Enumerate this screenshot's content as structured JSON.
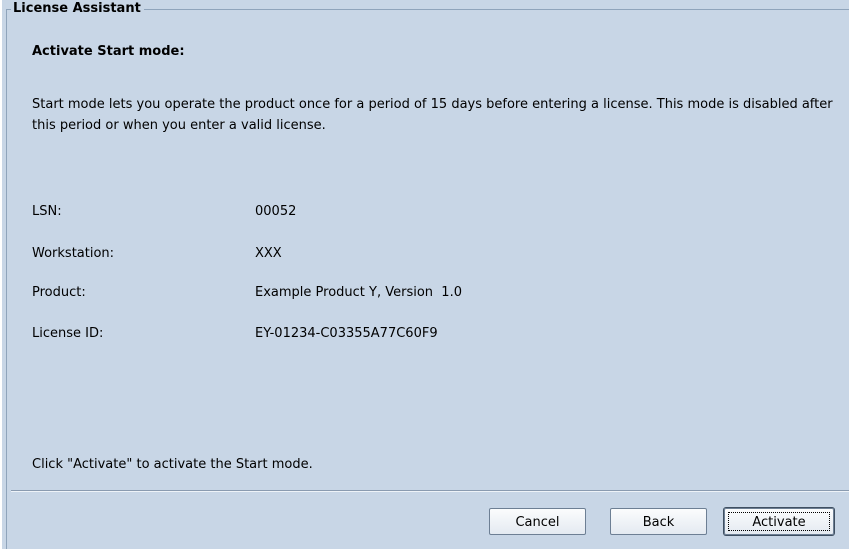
{
  "group_title": "License Assistant",
  "heading": "Activate Start mode:",
  "description": "Start mode lets you operate the product once for a period of 15 days before entering a license. This mode is disabled after this period or when you enter a valid license.",
  "fields": [
    {
      "label": "LSN:",
      "value": "00052"
    },
    {
      "label": "Workstation:",
      "value": "XXX"
    },
    {
      "label": "Product:",
      "value": "Example Product Y, Version  1.0"
    },
    {
      "label": "License ID:",
      "value": "EY-01234-C03355A77C60F9"
    }
  ],
  "hint": "Click \"Activate\" to activate the Start mode.",
  "buttons": {
    "cancel": "Cancel",
    "back": "Back",
    "activate": "Activate"
  },
  "colors": {
    "panel_background": "#c8d6e6",
    "border": "#8fa4bb"
  }
}
